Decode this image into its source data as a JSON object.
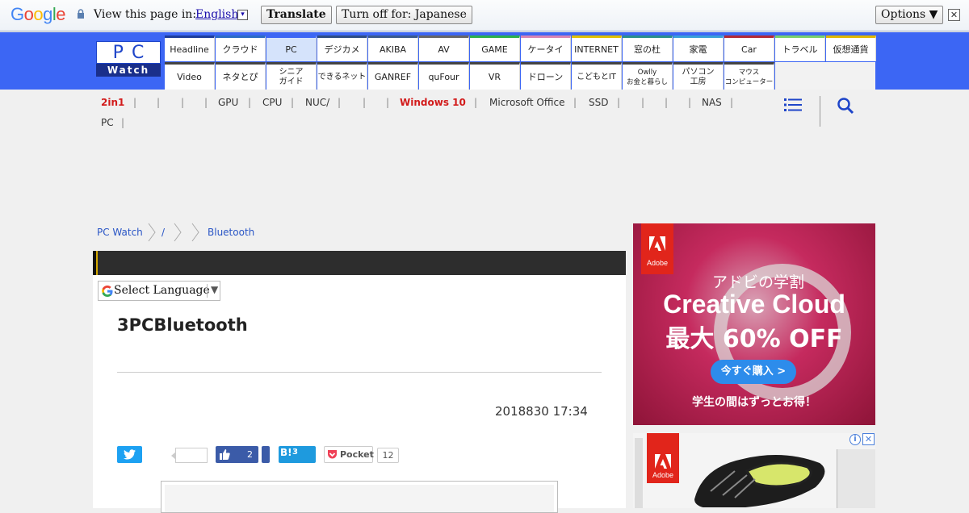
{
  "google_bar": {
    "logo": "Google",
    "view_text": "View this page in:",
    "language": "English",
    "translate_label": "Translate",
    "turn_off_label": "Turn off for: Japanese",
    "options_label": "Options ▼",
    "close_label": "✕"
  },
  "logo": {
    "pc": "PC",
    "watch": "Watch"
  },
  "nav_top": [
    "Headline",
    "クラウド",
    "PC",
    "デジカメ",
    "AKIBA",
    "AV",
    "GAME",
    "ケータイ",
    "INTERNET",
    "窓の杜",
    "家電",
    "Car",
    "トラベル",
    "仮想通貨"
  ],
  "nav_top_colors": [
    "#1d3d9b",
    "#2b6cc4",
    "#3c66f4",
    "#2e4d84",
    "#3a5a8c",
    "#666666",
    "#2bb04a",
    "#d684b3",
    "#e0c000",
    "#2a8f8a",
    "#3aa0d8",
    "#b22a35",
    "#7ad06a",
    "#e0b700"
  ],
  "nav_bottom": [
    "Video",
    "ネタとぴ",
    "シニア\nガイド",
    "できるネット",
    "GANREF",
    "quFour",
    "VR",
    "ドローン",
    "こどもとIT",
    "Owlly\nお金と暮らし",
    "パソコン\n工房",
    "マウス\nコンピューター"
  ],
  "tags": [
    "2in1",
    "GPU",
    "CPU",
    "NUC/",
    "Windows 10",
    "Microsoft Office",
    "SSD",
    "NAS",
    "PC"
  ],
  "breadcrumb": [
    "PC Watch",
    "/",
    "Bluetooth"
  ],
  "select_language": "Select Language",
  "article": {
    "title": "3PCBluetooth",
    "date": "2018830 17:34"
  },
  "share": {
    "fb_count": "2",
    "hatena_label": "B!",
    "hatena_count": "3",
    "pocket_label": "Pocket",
    "pocket_count": "12"
  },
  "ad1": {
    "brand": "Adobe",
    "line1": "アドビの学割",
    "line2": "Creative Cloud",
    "line3": "最大 60% OFF",
    "button": "今すぐ購入 >",
    "footer": "学生の間はずっとお得！"
  },
  "ad2": {
    "brand": "Adobe"
  }
}
